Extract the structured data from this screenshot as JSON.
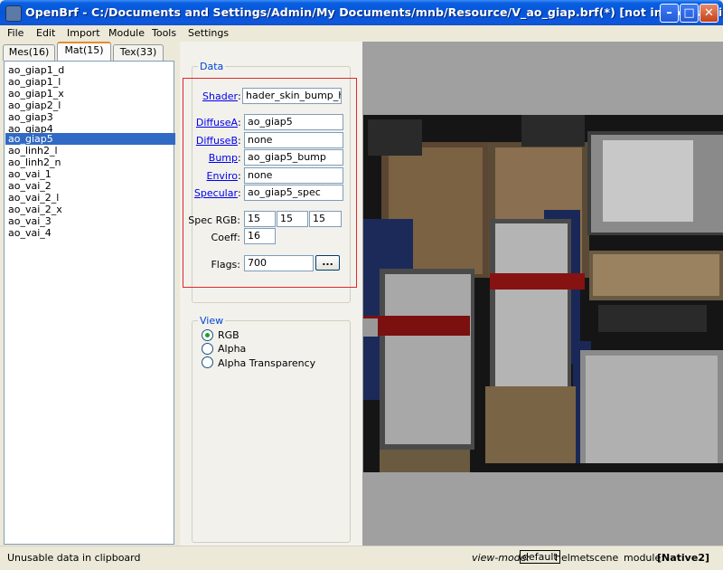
{
  "window": {
    "title": "OpenBrf - C:/Documents and Settings/Admin/My Documents/mnb/Resource/V_ao_giap.brf(*) [not in module.ini]",
    "min_label": "–",
    "max_label": "□",
    "close_label": "✕"
  },
  "menu": [
    "File",
    "Edit",
    "Import",
    "Module",
    "Tools",
    "Settings"
  ],
  "tabs": [
    "Mes(16)",
    "Mat(15)",
    "Tex(33)"
  ],
  "materials": [
    "ao_giap1_d",
    "ao_giap1_l",
    "ao_giap1_x",
    "ao_giap2_l",
    "ao_giap3",
    "ao_giap4",
    "ao_giap5",
    "ao_linh2_l",
    "ao_linh2_n",
    "ao_vai_1",
    "ao_vai_2",
    "ao_vai_2_l",
    "ao_vai_2_x",
    "ao_vai_3",
    "ao_vai_4"
  ],
  "selected_material": "ao_giap5",
  "data": {
    "group_title": "Data",
    "shader_label": "Shader",
    "shader_value": "hader_skin_bump_high",
    "diffuseA_label": "DiffuseA",
    "diffuseA_value": "ao_giap5",
    "diffuseB_label": "DiffuseB",
    "diffuseB_value": "none",
    "bump_label": "Bump",
    "bump_value": "ao_giap5_bump",
    "enviro_label": "Enviro",
    "enviro_value": "none",
    "specular_label": "Specular",
    "specular_value": "ao_giap5_spec",
    "spec_rgb_label": "Spec RGB:",
    "spec_rgb": [
      "15",
      "15",
      "15"
    ],
    "coeff_label": "Coeff:",
    "coeff_value": "16",
    "flags_label": "Flags:",
    "flags_value": "700",
    "flags_button": "..."
  },
  "view": {
    "group_title": "View",
    "options": [
      "RGB",
      "Alpha",
      "Alpha Transparency"
    ],
    "selected": "RGB"
  },
  "status": {
    "message": "Unusable data in clipboard",
    "view_mode_label": "view-mode:",
    "modes": [
      "default",
      "helmet",
      "scene"
    ],
    "active_mode": "default",
    "module_label": "module:",
    "module_value": "[Native2]"
  },
  "colors": {
    "title_bar": "#0554d8",
    "selection": "#316ac5",
    "highlight_box": "#e0282a",
    "link": "#0000ee",
    "group_title": "#0046d5"
  }
}
